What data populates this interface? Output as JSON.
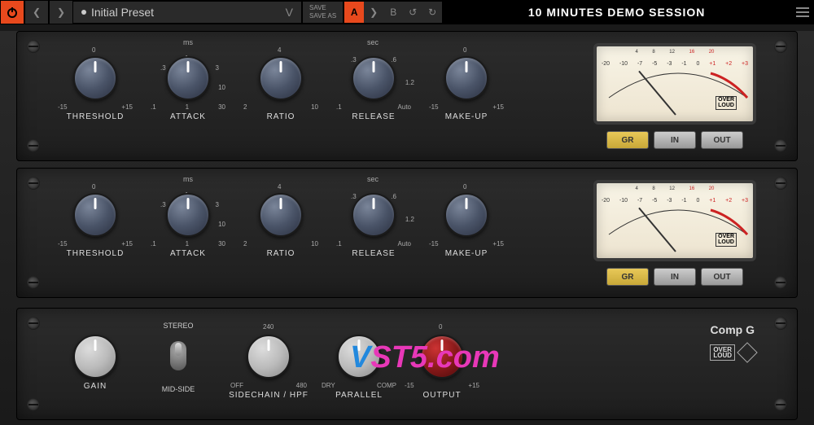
{
  "toolbar": {
    "preset_name": "Initial Preset",
    "save": "SAVE",
    "save_as": "SAVE AS",
    "ab_a": "A",
    "ab_b": "B",
    "demo": "10 MINUTES DEMO SESSION"
  },
  "channel": {
    "threshold": {
      "label": "THRESHOLD",
      "ticks": {
        "l": "-15",
        "c": "0",
        "r": "+15"
      }
    },
    "attack": {
      "label": "ATTACK",
      "unit": "ms",
      "ticks": {
        "l": ".1",
        "lm": ".3",
        "c": "1",
        "rm": "3",
        "rb": "10",
        "r": "30",
        "ll": "1"
      }
    },
    "ratio": {
      "label": "RATIO",
      "ticks": {
        "l": "2",
        "c": "4",
        "r": "10"
      }
    },
    "release": {
      "label": "RELEASE",
      "unit": "sec",
      "ticks": {
        "l": ".1",
        "lm": ".3",
        "c": ".6",
        "r": "1.2",
        "auto": "Auto"
      }
    },
    "makeup": {
      "label": "MAKE-UP",
      "ticks": {
        "l": "-15",
        "c": "0",
        "r": "+15"
      }
    }
  },
  "meter": {
    "ticks": [
      "-20",
      "-10",
      "-7",
      "-5",
      "-3",
      "-1",
      "0",
      "+1",
      "+2",
      "+3"
    ],
    "top": [
      "4",
      "8",
      "12",
      "16",
      "20"
    ],
    "logo": "OVER\nLOUD",
    "gr": "GR",
    "in": "IN",
    "out": "OUT"
  },
  "bottom": {
    "gain": {
      "label": "GAIN"
    },
    "stereo": {
      "top": "STEREO",
      "bottom": "MID-SIDE"
    },
    "hpf": {
      "label": "SIDECHAIN / HPF",
      "off": "OFF",
      "v240": "240",
      "v480": "480"
    },
    "parallel": {
      "label": "PARALLEL",
      "dry": "DRY",
      "comp": "COMP"
    },
    "output": {
      "label": "OUTPUT",
      "l": "-15",
      "c": "0",
      "r": "+15"
    }
  },
  "brand": {
    "name": "Comp G",
    "logo": "OVER\nLOUD"
  },
  "watermark": {
    "v": "V",
    "st5": "ST5.",
    "com": "com"
  }
}
